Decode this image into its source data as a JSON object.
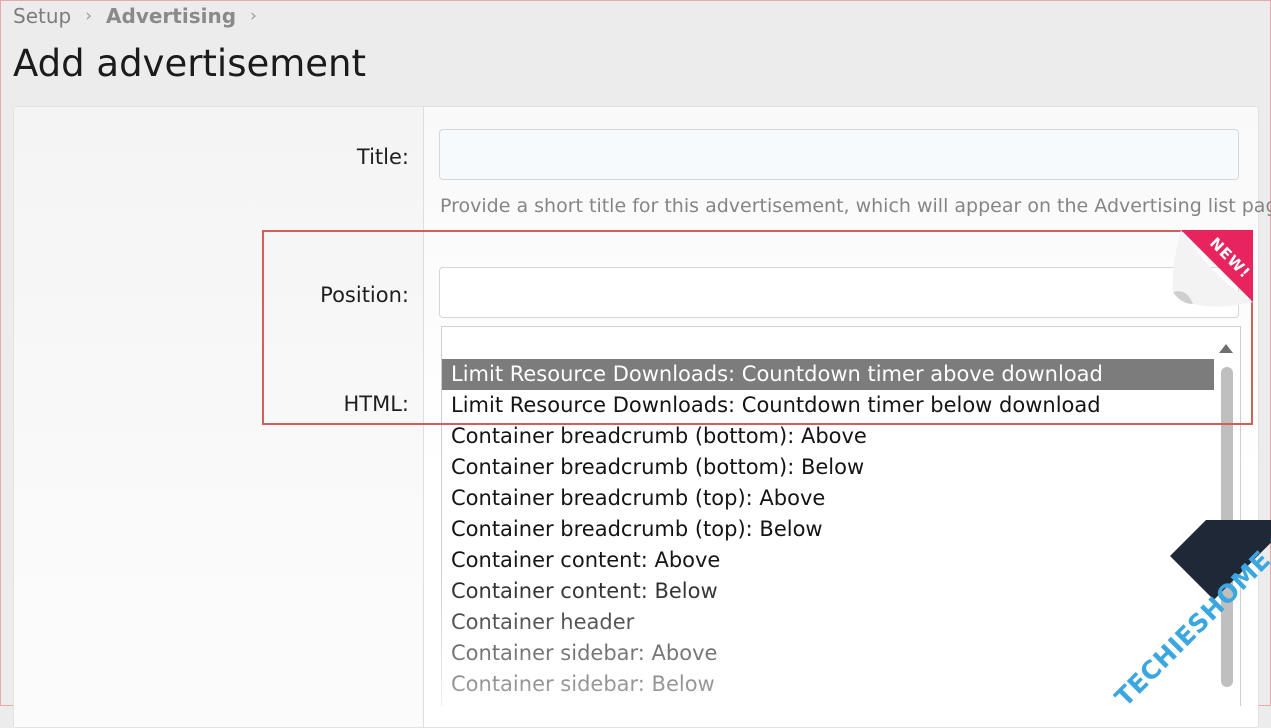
{
  "breadcrumb": {
    "items": [
      "Setup",
      "Advertising"
    ],
    "separator": "›"
  },
  "page_title": "Add advertisement",
  "form": {
    "title_label": "Title:",
    "title_value": "",
    "title_hint": "Provide a short title for this advertisement, which will appear on the Advertising list page.",
    "position_label": "Position:",
    "position_value": "",
    "html_label": "HTML:"
  },
  "position_options": [
    "",
    "Limit Resource Downloads: Countdown timer above download",
    "Limit Resource Downloads: Countdown timer below download",
    "Container breadcrumb (bottom): Above",
    "Container breadcrumb (bottom): Below",
    "Container breadcrumb (top): Above",
    "Container breadcrumb (top): Below",
    "Container content: Above",
    "Container content: Below",
    "Container header",
    "Container sidebar: Above",
    "Container sidebar: Below"
  ],
  "selected_option_index": 1,
  "badge": {
    "text": "NEW!",
    "color": "#e8245e"
  },
  "watermark": {
    "text": "TECHIESHOME.COM",
    "text_color": "#3aa7e0",
    "band_color": "#1f2836"
  },
  "colors": {
    "highlight": "#d0605a",
    "selected_bg": "#7c7c7c"
  }
}
